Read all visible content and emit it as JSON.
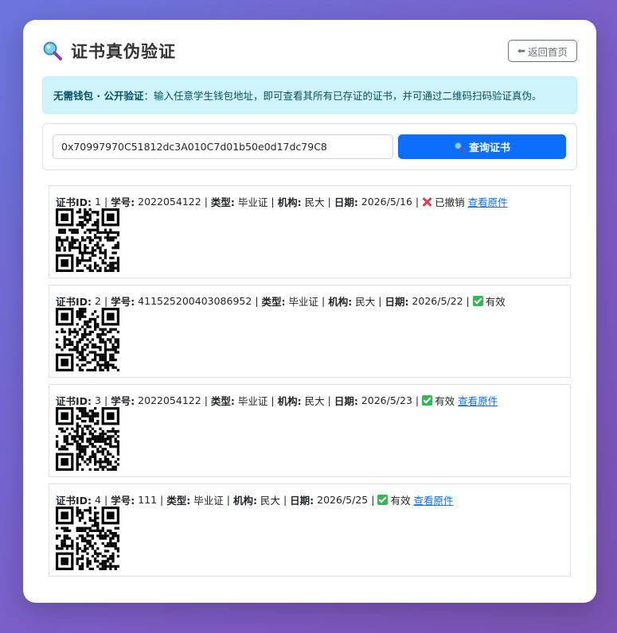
{
  "header": {
    "title": "证书真伪验证",
    "back_label": "返回首页"
  },
  "alert": {
    "bold": "无需钱包 · 公开验证",
    "text": "：输入任意学生钱包地址，即可查看其所有已存证的证书，并可通过二维码扫码验证真伪。"
  },
  "search": {
    "address": "0x70997970C51812dc3A010C7d01b50e0d17dc79C8",
    "button_label": "查询证书"
  },
  "labels": {
    "cert_id": "证书ID:",
    "student_no": "学号:",
    "type": "类型:",
    "org": "机构:",
    "date": "日期:",
    "view": "查看原件"
  },
  "certificates": [
    {
      "id": "1",
      "student_no": "2022054122",
      "type": "毕业证",
      "org": "民大",
      "date": "2026/5/16",
      "status": "已撤销",
      "status_kind": "revoked",
      "has_link": true
    },
    {
      "id": "2",
      "student_no": "411525200403086952",
      "type": "毕业证",
      "org": "民大",
      "date": "2026/5/22",
      "status": "有效",
      "status_kind": "valid",
      "has_link": false
    },
    {
      "id": "3",
      "student_no": "2022054122",
      "type": "毕业证",
      "org": "民大",
      "date": "2026/5/23",
      "status": "有效",
      "status_kind": "valid",
      "has_link": true
    },
    {
      "id": "4",
      "student_no": "111",
      "type": "毕业证",
      "org": "民大",
      "date": "2026/5/25",
      "status": "有效",
      "status_kind": "valid",
      "has_link": true
    }
  ],
  "colors": {
    "accent": "#0d6efd",
    "valid": "#3cb35b",
    "revoked": "#e03b52",
    "alert_bg": "#cff4fc"
  },
  "icons": {
    "title": "magnifier-icon",
    "back": "arrow-left-icon",
    "query": "magnifier-icon",
    "valid": "check-box-icon",
    "revoked": "cross-icon"
  }
}
